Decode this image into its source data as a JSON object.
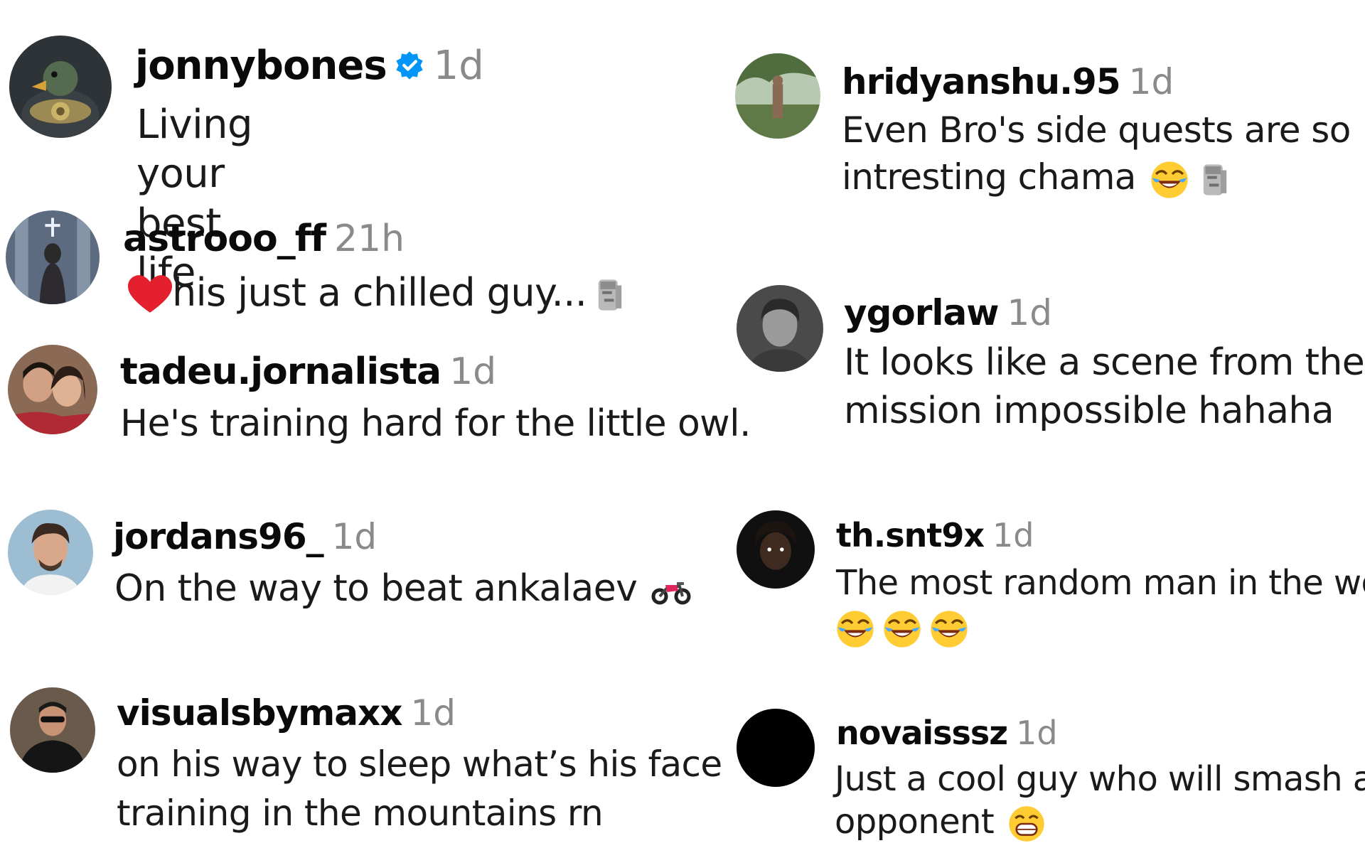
{
  "comments": [
    {
      "username": "jonnybones",
      "verified": true,
      "time": "1d",
      "text": "Living your best life",
      "avatar_icon": "duck-champion-avatar"
    },
    {
      "username": "astrooo_ff",
      "time": "21h",
      "text": "his just a chilled guy...",
      "emoji_before": "red-heart",
      "emoji_after": "moai"
    },
    {
      "username": "tadeu.jornalista",
      "time": "1d",
      "text": "He's training hard for the little owl.",
      "avatar_icon": "couple-photo-avatar"
    },
    {
      "username": "jordans96_",
      "time": "1d",
      "text": "On the way to beat ankalaev",
      "emoji_after": "motorcycle"
    },
    {
      "username": "visualsbymaxx",
      "time": "1d",
      "line1": "on his way to sleep what’s his face",
      "line2": "training in the mountains rn"
    },
    {
      "username": "hridyanshu.95",
      "time": "1d",
      "line1": "Even Bro's side quests are so",
      "line2": "intresting chama",
      "emoji_after": [
        "face-with-tears-of-joy",
        "moai"
      ]
    },
    {
      "username": "ygorlaw",
      "time": "1d",
      "line1": "It looks like a scene from the",
      "line2": "mission impossible hahaha"
    },
    {
      "username": "th.snt9x",
      "time": "1d",
      "line1": "The most random man in the world",
      "emoji_line": [
        "face-with-tears-of-joy",
        "face-with-tears-of-joy",
        "face-with-tears-of-joy"
      ]
    },
    {
      "username": "novaisssz",
      "time": "1d",
      "line1": "Just a cool guy who will smash any",
      "line2": "opponent",
      "emoji_after": "grinning-face"
    }
  ],
  "colors": {
    "verified_badge": "#0095f6",
    "timestamp": "#8a8a8a",
    "text": "#1a1a1a"
  }
}
